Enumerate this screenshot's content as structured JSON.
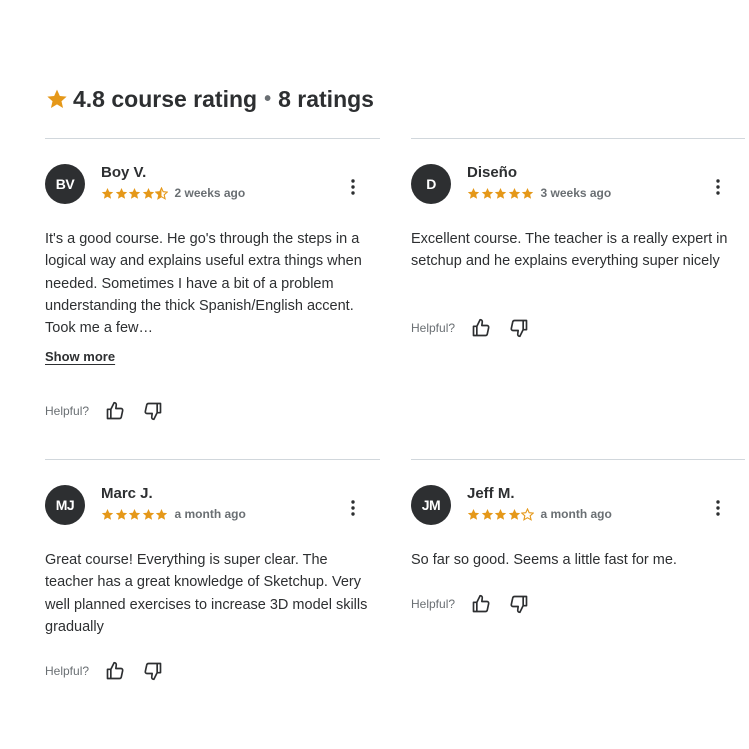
{
  "summary": {
    "rating": "4.8 course rating",
    "separator": "•",
    "count": "8 ratings",
    "star_icon": "star-icon",
    "star_color": "#e59819"
  },
  "reviews": [
    {
      "initials": "BV",
      "name": "Boy V.",
      "stars": 4.5,
      "date": "2 weeks ago",
      "text": "It's a good course. He go's through the steps in a logical way and explains useful extra things when needed. Sometimes I have a bit of a problem understanding the thick Spanish/English accent. Took me a few…",
      "show_more": "Show more",
      "helpful_label": "Helpful?"
    },
    {
      "initials": "D",
      "name": "Diseño",
      "stars": 5,
      "date": "3 weeks ago",
      "text": "Excellent course. The teacher is a really expert in setchup and he explains everything super nicely",
      "helpful_label": "Helpful?"
    },
    {
      "initials": "MJ",
      "name": "Marc J.",
      "stars": 5,
      "date": "a month ago",
      "text": "Great course! Everything is super clear. The teacher has a great knowledge of Sketchup. Very well planned exercises to increase 3D model skills gradually",
      "helpful_label": "Helpful?"
    },
    {
      "initials": "JM",
      "name": "Jeff M.",
      "stars": 4,
      "date": "a month ago",
      "text": "So far so good. Seems a little fast for me.",
      "helpful_label": "Helpful?"
    }
  ],
  "icons": {
    "more": "more-vertical-icon",
    "thumbs_up": "thumbs-up-icon",
    "thumbs_down": "thumbs-down-icon"
  },
  "colors": {
    "star": "#e59819",
    "avatar_bg": "#2d2f31",
    "text": "#2d2f31",
    "muted": "#6a6f73",
    "divider": "#d1d7dc"
  }
}
